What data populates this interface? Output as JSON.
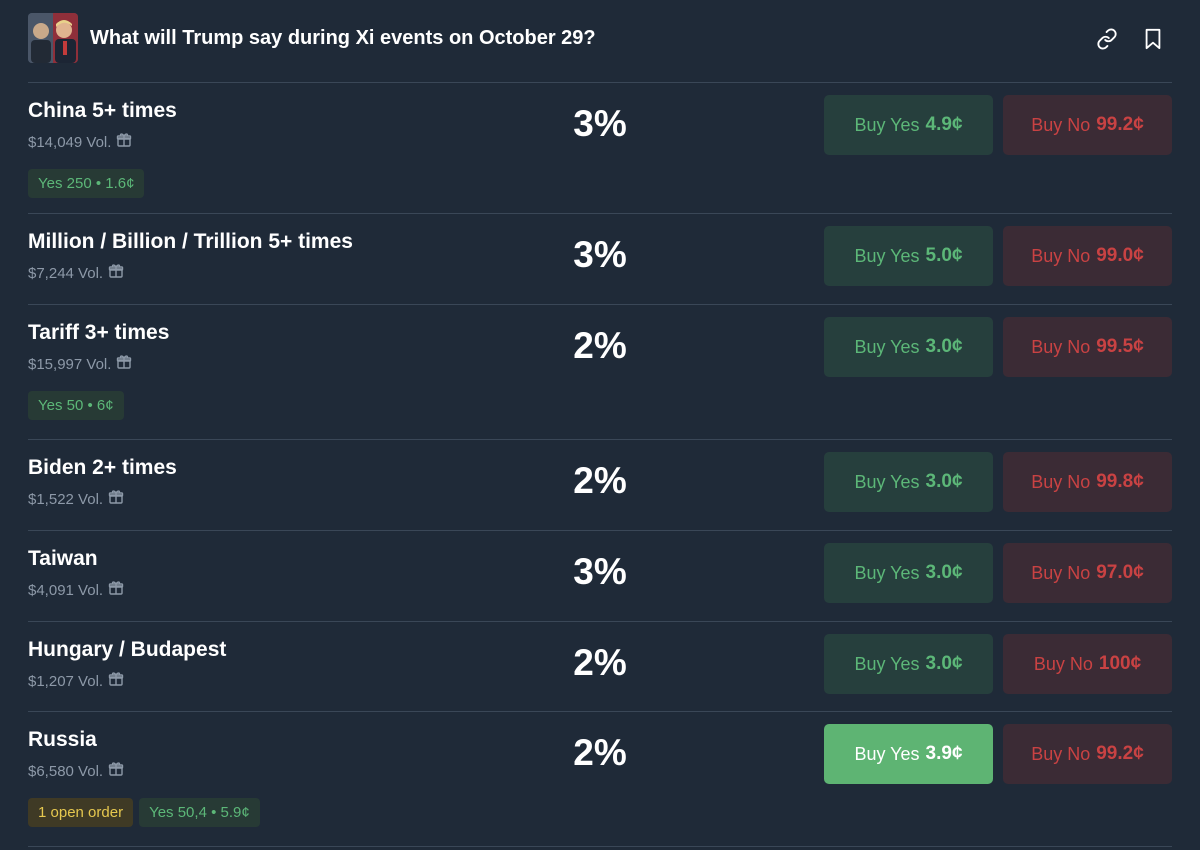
{
  "header": {
    "title": "What will Trump say during Xi events on October 29?",
    "thumbnail_alt": "Xi and Trump photo"
  },
  "markets": [
    {
      "title": "China 5+ times",
      "volume": "$14,049 Vol.",
      "probability": "3%",
      "yes_label": "Buy Yes",
      "yes_price": "4.9¢",
      "no_label": "Buy No",
      "no_price": "99.2¢",
      "badges": [
        {
          "type": "yes",
          "text": "Yes 250 • 1.6¢"
        }
      ]
    },
    {
      "title": "Million / Billion / Trillion 5+ times",
      "volume": "$7,244 Vol.",
      "probability": "3%",
      "yes_label": "Buy Yes",
      "yes_price": "5.0¢",
      "no_label": "Buy No",
      "no_price": "99.0¢",
      "badges": []
    },
    {
      "title": "Tariff 3+ times",
      "volume": "$15,997 Vol.",
      "probability": "2%",
      "yes_label": "Buy Yes",
      "yes_price": "3.0¢",
      "no_label": "Buy No",
      "no_price": "99.5¢",
      "badges": [
        {
          "type": "yes",
          "text": "Yes 50 • 6¢"
        }
      ]
    },
    {
      "title": "Biden 2+ times",
      "volume": "$1,522 Vol.",
      "probability": "2%",
      "yes_label": "Buy Yes",
      "yes_price": "3.0¢",
      "no_label": "Buy No",
      "no_price": "99.8¢",
      "badges": []
    },
    {
      "title": "Taiwan",
      "volume": "$4,091 Vol.",
      "probability": "3%",
      "yes_label": "Buy Yes",
      "yes_price": "3.0¢",
      "no_label": "Buy No",
      "no_price": "97.0¢",
      "badges": []
    },
    {
      "title": "Hungary / Budapest",
      "volume": "$1,207 Vol.",
      "probability": "2%",
      "yes_label": "Buy Yes",
      "yes_price": "3.0¢",
      "no_label": "Buy No",
      "no_price": "100¢",
      "badges": []
    },
    {
      "title": "Russia",
      "volume": "$6,580 Vol.",
      "probability": "2%",
      "yes_label": "Buy Yes",
      "yes_price": "3.9¢",
      "no_label": "Buy No",
      "no_price": "99.2¢",
      "yes_active": true,
      "badges": [
        {
          "type": "order",
          "text": "1 open order"
        },
        {
          "type": "yes",
          "text": "Yes 50,4 • 5.9¢"
        }
      ]
    }
  ],
  "colors": {
    "background": "#1f2a38",
    "yes_green": "#5cb778",
    "no_red": "#c94243",
    "order_yellow": "#e6c84f"
  },
  "icons": {
    "link": "link-icon",
    "bookmark": "bookmark-icon",
    "gift": "gift-icon"
  }
}
